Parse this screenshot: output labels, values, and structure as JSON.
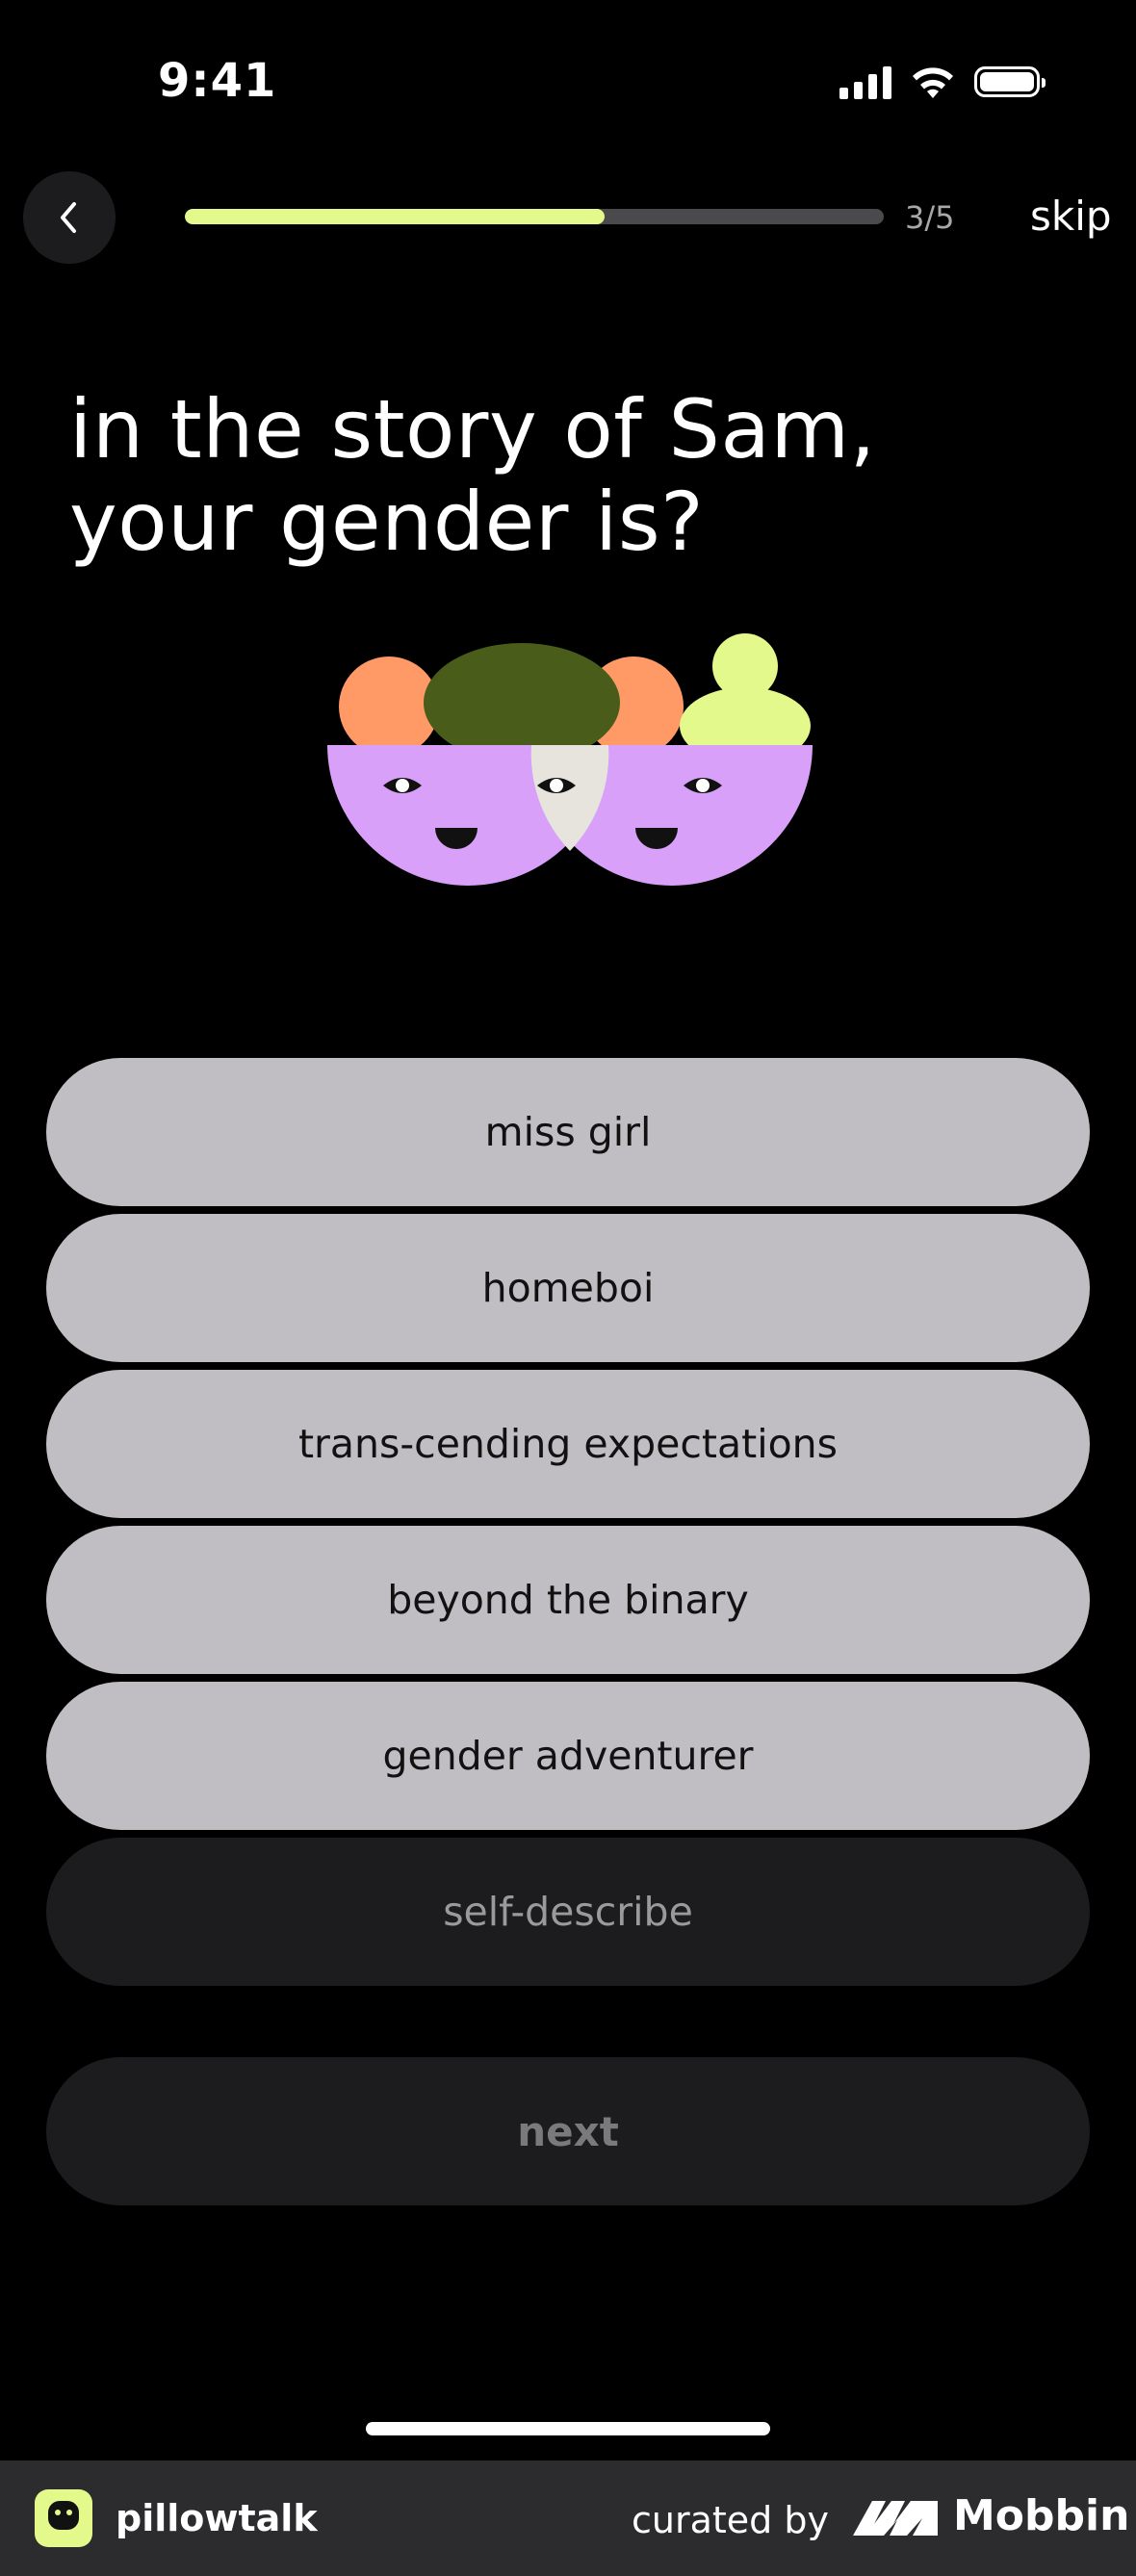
{
  "status_bar": {
    "time": "9:41"
  },
  "header": {
    "progress_text": "3/5",
    "progress_fraction": 0.6,
    "skip_label": "skip"
  },
  "question": {
    "line1": "in the story of Sam,",
    "line2": "your gender is?"
  },
  "options": [
    {
      "label": "miss girl"
    },
    {
      "label": "homeboi"
    },
    {
      "label": "trans-cending expectations"
    },
    {
      "label": "beyond the binary"
    },
    {
      "label": "gender adventurer"
    },
    {
      "label": "self-describe"
    }
  ],
  "next_label": "next",
  "footer": {
    "app_name": "pillowtalk",
    "curated_by": "curated by",
    "brand": "Mobbin"
  },
  "colors": {
    "accent": "#e4f98c",
    "option_bg": "#c0bec2",
    "dark_button": "#1c1c1e",
    "face_purple": "#d8a0f8",
    "hair_orange": "#ff9a66",
    "hair_olive": "#4a5c1a"
  },
  "icons": [
    "back-chevron-icon",
    "cellular-signal-icon",
    "wifi-icon",
    "battery-icon"
  ]
}
